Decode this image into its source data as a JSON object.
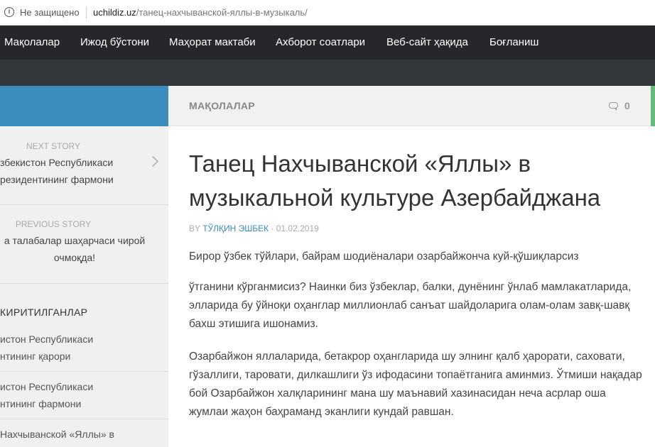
{
  "browser": {
    "security_label": "Не защищено",
    "url_domain": "uchildiz.uz",
    "url_path": "/танец-нахчыванской-яллы-в-музыкаль/"
  },
  "nav": {
    "items": [
      {
        "label": "Мақолалар"
      },
      {
        "label": "Ижод бўстони"
      },
      {
        "label": "Маҳорат мактаби"
      },
      {
        "label": "Ахборот соатлари"
      },
      {
        "label": "Веб-сайт ҳақида"
      },
      {
        "label": "Боғланиш"
      }
    ]
  },
  "sidebar": {
    "next_label": "NEXT STORY",
    "next_title_line1": "збекистон Республикаси",
    "next_title_line2": "резидентининг фармони",
    "prev_label": "PREVIOUS STORY",
    "prev_title_line1": "а талабалар шаҳарчаси чирой",
    "prev_title_line2": "очмоқда!",
    "widget_title": "КИРИТИЛГАНЛАР",
    "recent": [
      {
        "line1": "истон Республикаси",
        "line2": "нтининг қарори"
      },
      {
        "line1": "истон Республикаси",
        "line2": "нтининг фармони"
      },
      {
        "line1": "Нахчыванской «Яллы» в",
        "line2": ""
      }
    ]
  },
  "article": {
    "category": "МАҚОЛАЛАР",
    "comments": "0",
    "title": "Танец Нахчыванской «Яллы» в музыкальной культуре Азербайджана",
    "by": "BY",
    "author": "ТЎЛҚИН ЭШБЕК",
    "date": "· 01.02.2019",
    "paragraphs": [
      "Бирор ўзбек тўйлари, байрам шодиёналари озарбайжонча куй-қўшиқларсиз",
      "ўтганини кўрганмисиз? Наинки биз ўзбеклар, балки, дунёнинг ўнлаб мамлакатларида, элларида бу ўйноқи оҳанглар миллионлаб санъат шайдоларига олам-олам завқ-шавқ бахш этишига ишонамиз.",
      "Озарбайжон яллаларида, бетакрор оҳангларида шу элнинг қалб ҳарорати, саховати, гўзаллиги, таровати, дилкашлиги ўз ифодасини топаётганига аминмиз. Ўтмиши нақадар бой Озарбайжон халқларининг мана шу маънавий хазинасидан неча асрлар оша жумлаи жаҳон баҳраманд эканлиги кундай равшан."
    ]
  }
}
